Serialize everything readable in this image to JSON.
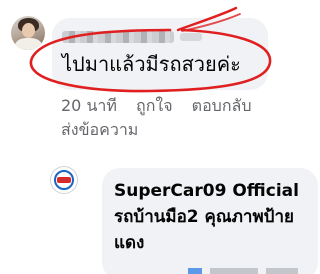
{
  "comment": {
    "text": "ไปมาแล้วมีรถสวยค่ะ",
    "time": "20 นาที",
    "like_label": "ถูกใจ",
    "reply_label": "ตอบกลับ",
    "send_label": "ส่งข้อความ"
  },
  "reply": {
    "author_text": "SuperCar09 Official รถบ้านมือ2 คุณภาพป้ายแดง"
  },
  "colors": {
    "bubble": "#f0f2f5",
    "text": "#050505",
    "meta": "#65676b",
    "annotation": "#e02020",
    "brand": "#1a64c8"
  }
}
